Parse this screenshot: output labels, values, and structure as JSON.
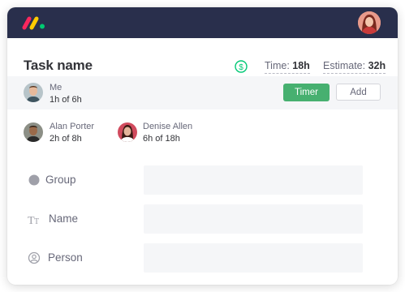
{
  "header": {
    "logo_icon": "monday-logo-icon",
    "logo_colors": [
      "#fb275d",
      "#ffcb00",
      "#00ca72"
    ],
    "background_color": "#292f4c",
    "user_avatar_icon": "user-avatar"
  },
  "task": {
    "title": "Task name",
    "billing_icon": "dollar-circle-icon",
    "time_label": "Time:",
    "time_value": "18h",
    "estimate_label": "Estimate:",
    "estimate_value": "32h"
  },
  "me": {
    "name": "Me",
    "hours": "1h of 6h",
    "timer_label": "Timer",
    "add_label": "Add",
    "timer_color": "#47b070"
  },
  "people": [
    {
      "name": "Alan Porter",
      "hours": "2h of 8h"
    },
    {
      "name": "Denise Allen",
      "hours": "6h of 18h"
    }
  ],
  "fields": [
    {
      "label": "Group",
      "icon": "group-circle-icon"
    },
    {
      "label": "Name",
      "icon": "text-type-icon"
    },
    {
      "label": "Person",
      "icon": "person-icon"
    }
  ]
}
